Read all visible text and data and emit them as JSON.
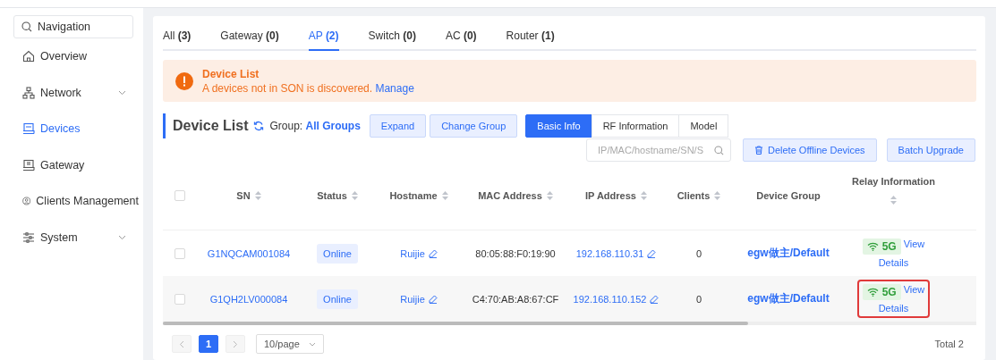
{
  "sidebar": {
    "search": {
      "placeholder": "Navigation"
    },
    "items": [
      {
        "label": "Overview",
        "expandable": false,
        "selected": false
      },
      {
        "label": "Network",
        "expandable": true,
        "selected": false
      },
      {
        "label": "Devices",
        "expandable": false,
        "selected": true
      },
      {
        "label": "Gateway",
        "expandable": false,
        "selected": false
      },
      {
        "label": "Clients Management",
        "expandable": false,
        "selected": false
      },
      {
        "label": "System",
        "expandable": true,
        "selected": false
      }
    ]
  },
  "tabs": [
    {
      "label": "All",
      "count": "(3)",
      "selected": false
    },
    {
      "label": "Gateway",
      "count": "(0)",
      "selected": false
    },
    {
      "label": "AP",
      "count": "(2)",
      "selected": true
    },
    {
      "label": "Switch",
      "count": "(0)",
      "selected": false
    },
    {
      "label": "AC",
      "count": "(0)",
      "selected": false
    },
    {
      "label": "Router",
      "count": "(1)",
      "selected": false
    }
  ],
  "alert": {
    "title": "Device List",
    "message": "A devices not in SON is discovered.",
    "link": "Manage"
  },
  "list_header": {
    "title": "Device List",
    "group_label": "Group:",
    "group_value": "All Groups",
    "buttons": [
      "Expand",
      "Change Group"
    ],
    "views": [
      {
        "label": "Basic Info",
        "selected": true
      },
      {
        "label": "RF Information",
        "selected": false
      },
      {
        "label": "Model",
        "selected": false
      }
    ]
  },
  "toolbar": {
    "search_placeholder": "IP/MAC/hostname/SN/S",
    "delete_button": "Delete Offline Devices",
    "upgrade_button": "Batch Upgrade"
  },
  "table": {
    "all_checked": false,
    "columns": [
      {
        "label": "SN",
        "sortable": true
      },
      {
        "label": "Status",
        "sortable": true
      },
      {
        "label": "Hostname",
        "sortable": true
      },
      {
        "label": "MAC Address",
        "sortable": true
      },
      {
        "label": "IP Address",
        "sortable": true
      },
      {
        "label": "Clients",
        "sortable": true
      },
      {
        "label": "Device Group",
        "sortable": false
      },
      {
        "label": "Relay Information",
        "sortable": true
      }
    ],
    "rows": [
      {
        "checked": false,
        "highlighted": false,
        "sn": "G1NQCAM001084",
        "status": "Online",
        "hostname": "Ruijie",
        "mac": "80:05:88:F0:19:90",
        "ip": "192.168.110.31",
        "clients": "0",
        "group": "egw做主/Default",
        "relay_band": "5G",
        "relay_link_1": "View",
        "relay_link_2": "Details"
      },
      {
        "checked": false,
        "highlighted": true,
        "sn": "G1QH2LV000084",
        "status": "Online",
        "hostname": "Ruijie",
        "mac": "C4:70:AB:A8:67:CF",
        "ip": "192.168.110.152",
        "clients": "0",
        "group": "egw做主/Default",
        "relay_band": "5G",
        "relay_link_1": "View",
        "relay_link_2": "Details"
      }
    ]
  },
  "pagination": {
    "pages": [
      {
        "label": "1",
        "selected": true
      }
    ],
    "page_size": "10/page",
    "total": "Total 2"
  }
}
